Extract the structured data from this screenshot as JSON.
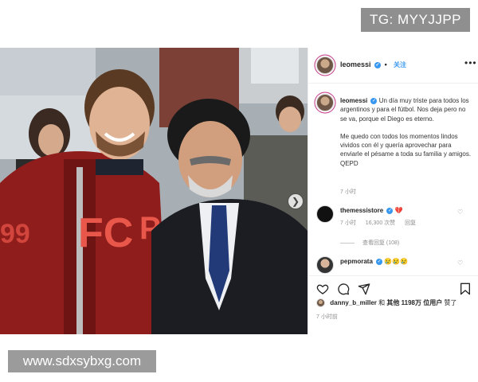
{
  "watermarks": {
    "top": "TG: MYYJJPP",
    "bottom": "www.sdxsybxg.com"
  },
  "header": {
    "username": "leomessi",
    "separator": "•",
    "follow": "关注"
  },
  "caption": {
    "username": "leomessi",
    "paragraph1": "Un día muy triste para todos los argentinos y para el fútbol. Nos deja pero no se va, porque el Diego es eterno.",
    "paragraph2": "Me quedo con todos los momentos lindos vividos con él y quería aprovechar para enviarle el pésame a toda su familia y amigos. QEPD",
    "time": "7 小时"
  },
  "comments": [
    {
      "username": "themessistore",
      "text": "💔",
      "time": "7 小时",
      "likes": "16,300 次赞",
      "reply": "回复",
      "view_replies": "查看回复 (108)"
    },
    {
      "username": "pepmorata",
      "text": "😢😢😢"
    }
  ],
  "likes": {
    "prefix": "danny_b_miller",
    "and": "和",
    "others": "其他 1198万 位用户",
    "suffix": "赞了"
  },
  "post_time": "7 小时前",
  "colors": {
    "accent": "#3897f0",
    "hoodie": "#8b1a1a",
    "background": "#ffffff"
  },
  "icons": [
    "heart-icon",
    "comment-icon",
    "share-icon",
    "bookmark-icon",
    "verified-icon",
    "more-icon",
    "chevron-right-icon"
  ]
}
